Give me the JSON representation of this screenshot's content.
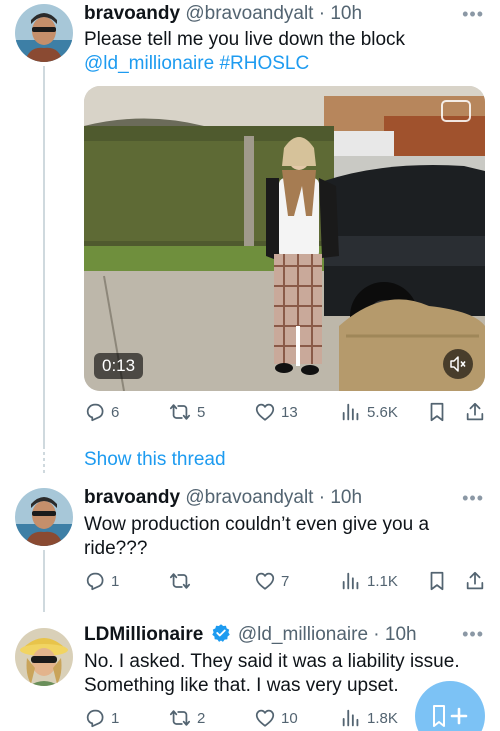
{
  "tweets": [
    {
      "display_name": "bravoandy",
      "handle_time": "@bravoandyalt · 10h",
      "text_line1": "Please tell me you live down the block",
      "mention": "@ld_millionaire",
      "hashtag": "#RHOSLC",
      "video_time": "0:13",
      "replies": "6",
      "retweets": "5",
      "likes": "13",
      "views": "5.6K"
    },
    {
      "display_name": "bravoandy",
      "handle_time": "@bravoandyalt · 10h",
      "text": "Wow production couldn’t even give you a ride???",
      "replies": "1",
      "retweets": "",
      "likes": "7",
      "views": "1.1K"
    },
    {
      "display_name": "LDMillionaire",
      "handle_time": "@ld_millionaire · 10h",
      "text": "No. I asked. They said it was a liability issue. Something like that. I was very upset.",
      "replies": "1",
      "retweets": "2",
      "likes": "10",
      "views": "1.8K"
    }
  ],
  "show_thread": "Show this thread",
  "colors": {
    "accent": "#1d9bf0",
    "secondary_text": "#536471",
    "verified": "#1d9bf0"
  },
  "icons": [
    "reply-icon",
    "retweet-icon",
    "like-icon",
    "views-icon",
    "bookmark-icon",
    "share-icon",
    "more-icon",
    "mute-icon",
    "captions-icon",
    "compose-icon",
    "verified-badge-icon"
  ]
}
